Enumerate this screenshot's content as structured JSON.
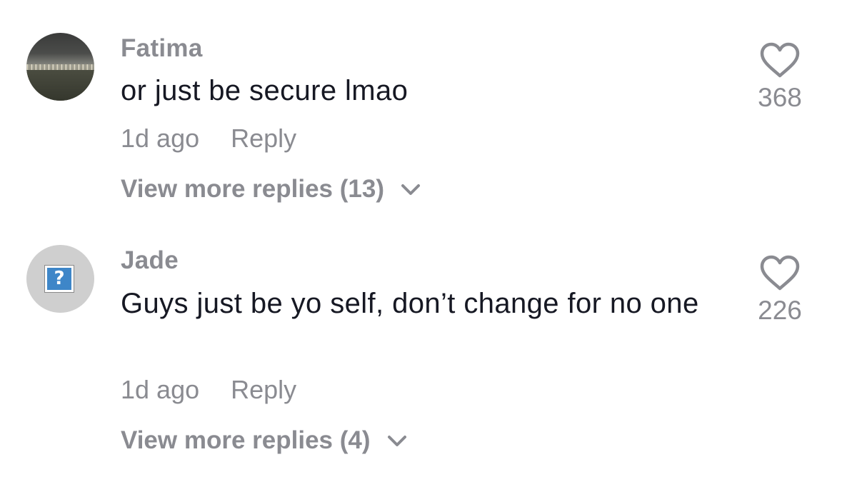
{
  "comments": [
    {
      "username": "Fatima",
      "text": "or just be secure lmao",
      "time": "1d ago",
      "reply_label": "Reply",
      "view_more_label": "View more replies (13)",
      "like_count": "368",
      "avatar_icon": "city-skyline-photo"
    },
    {
      "username": "Jade",
      "text": "Guys just be yo self, don’t change for no one",
      "time": "1d ago",
      "reply_label": "Reply",
      "view_more_label": "View more replies (4)",
      "like_count": "226",
      "avatar_icon": "question-mark-placeholder",
      "avatar_glyph": "?"
    }
  ],
  "colors": {
    "text_primary": "#161823",
    "text_secondary": "#8a8b91",
    "background": "#ffffff"
  }
}
